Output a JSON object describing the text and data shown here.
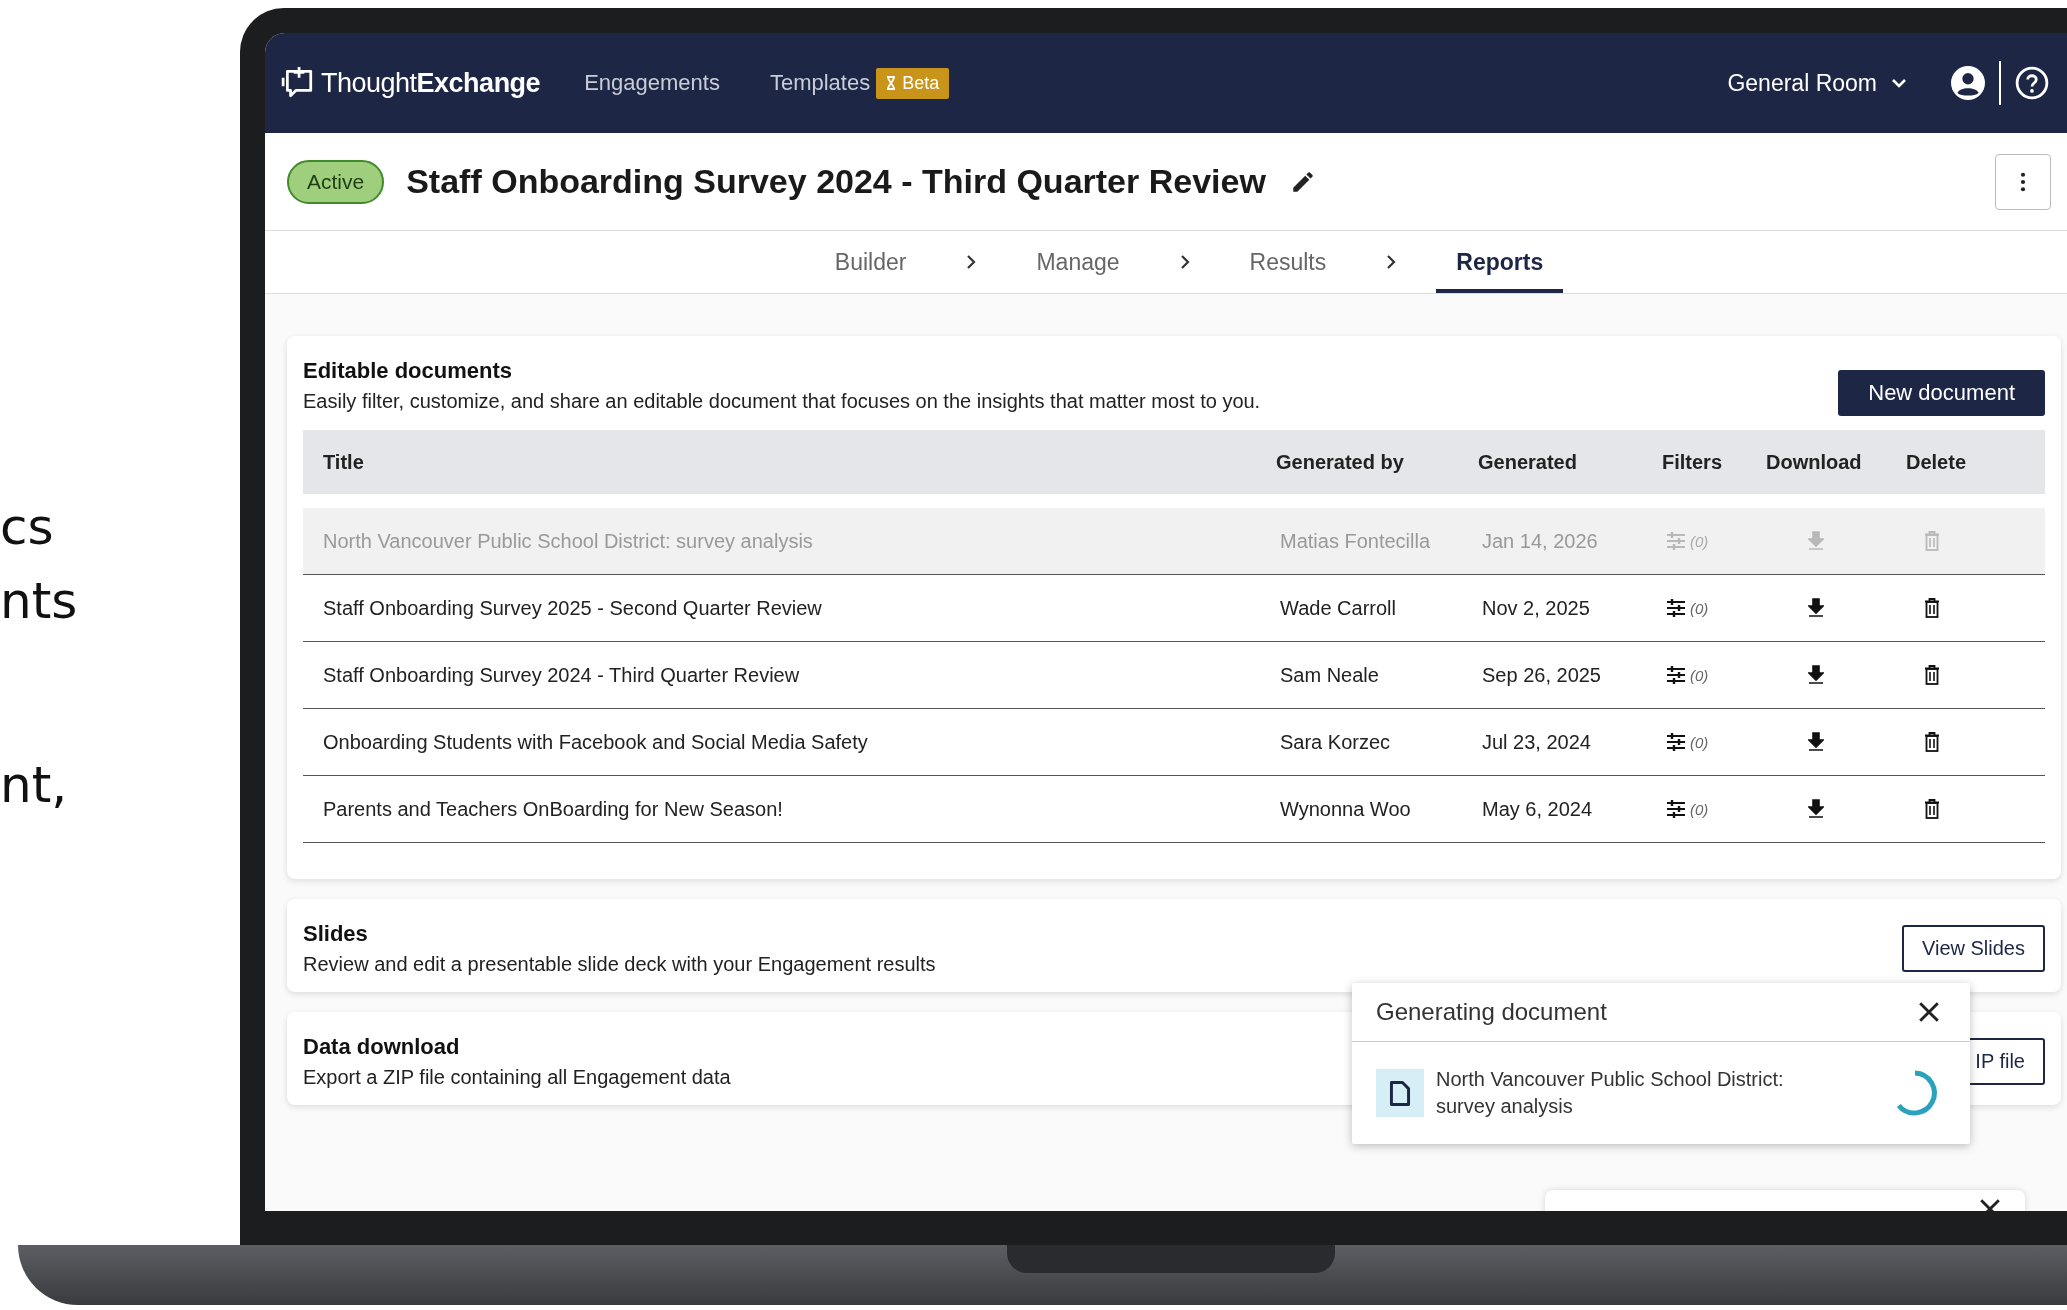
{
  "slide_text": [
    "cs",
    "nts",
    "nt,"
  ],
  "nav": {
    "logo": "Thought**Exchange**",
    "links": [
      {
        "label": "Engagements"
      },
      {
        "label": "Templates",
        "badge": "Beta"
      }
    ],
    "room": "General Room"
  },
  "header": {
    "status": "Active",
    "title": "Staff Onboarding Survey 2024 - Third Quarter Review"
  },
  "steps": [
    {
      "label": "Builder",
      "selected": false
    },
    {
      "label": "Manage",
      "selected": false
    },
    {
      "label": "Results",
      "selected": false
    },
    {
      "label": "Reports",
      "selected": true
    }
  ],
  "editable_documents": {
    "title": "Editable documents",
    "description": "Easily filter, customize, and share an editable document that focuses on the insights that matter most to you.",
    "button": "New document",
    "columns": [
      "Title",
      "Generated by",
      "Generated",
      "Filters",
      "Download",
      "Delete"
    ],
    "rows": [
      {
        "title": "North Vancouver Public School District: survey analysis",
        "generated_by": "Matias Fontecilla",
        "generated": "Jan 14, 2026",
        "filters": "(0)",
        "disabled": true
      },
      {
        "title": "Staff Onboarding Survey 2025 - Second Quarter Review",
        "generated_by": "Wade Carroll",
        "generated": "Nov 2, 2025",
        "filters": "(0)",
        "disabled": false
      },
      {
        "title": "Staff Onboarding Survey 2024 - Third Quarter Review",
        "generated_by": "Sam Neale",
        "generated": "Sep 26, 2025",
        "filters": "(0)",
        "disabled": false
      },
      {
        "title": "Onboarding Students with Facebook and Social Media Safety",
        "generated_by": "Sara Korzec",
        "generated": "Jul 23, 2024",
        "filters": "(0)",
        "disabled": false
      },
      {
        "title": "Parents and Teachers OnBoarding for New Season!",
        "generated_by": "Wynonna Woo",
        "generated": "May 6, 2024",
        "filters": "(0)",
        "disabled": false
      }
    ]
  },
  "sections": [
    {
      "title": "Slides",
      "description": "Review and edit a presentable slide deck with your Engagement results",
      "button": "View Slides"
    },
    {
      "title": "Data download",
      "description": "Export a ZIP file containing all Engagement data",
      "button": "IP file"
    }
  ],
  "toast": {
    "title": "Generating document",
    "item": "North Vancouver Public School District: survey analysis"
  }
}
